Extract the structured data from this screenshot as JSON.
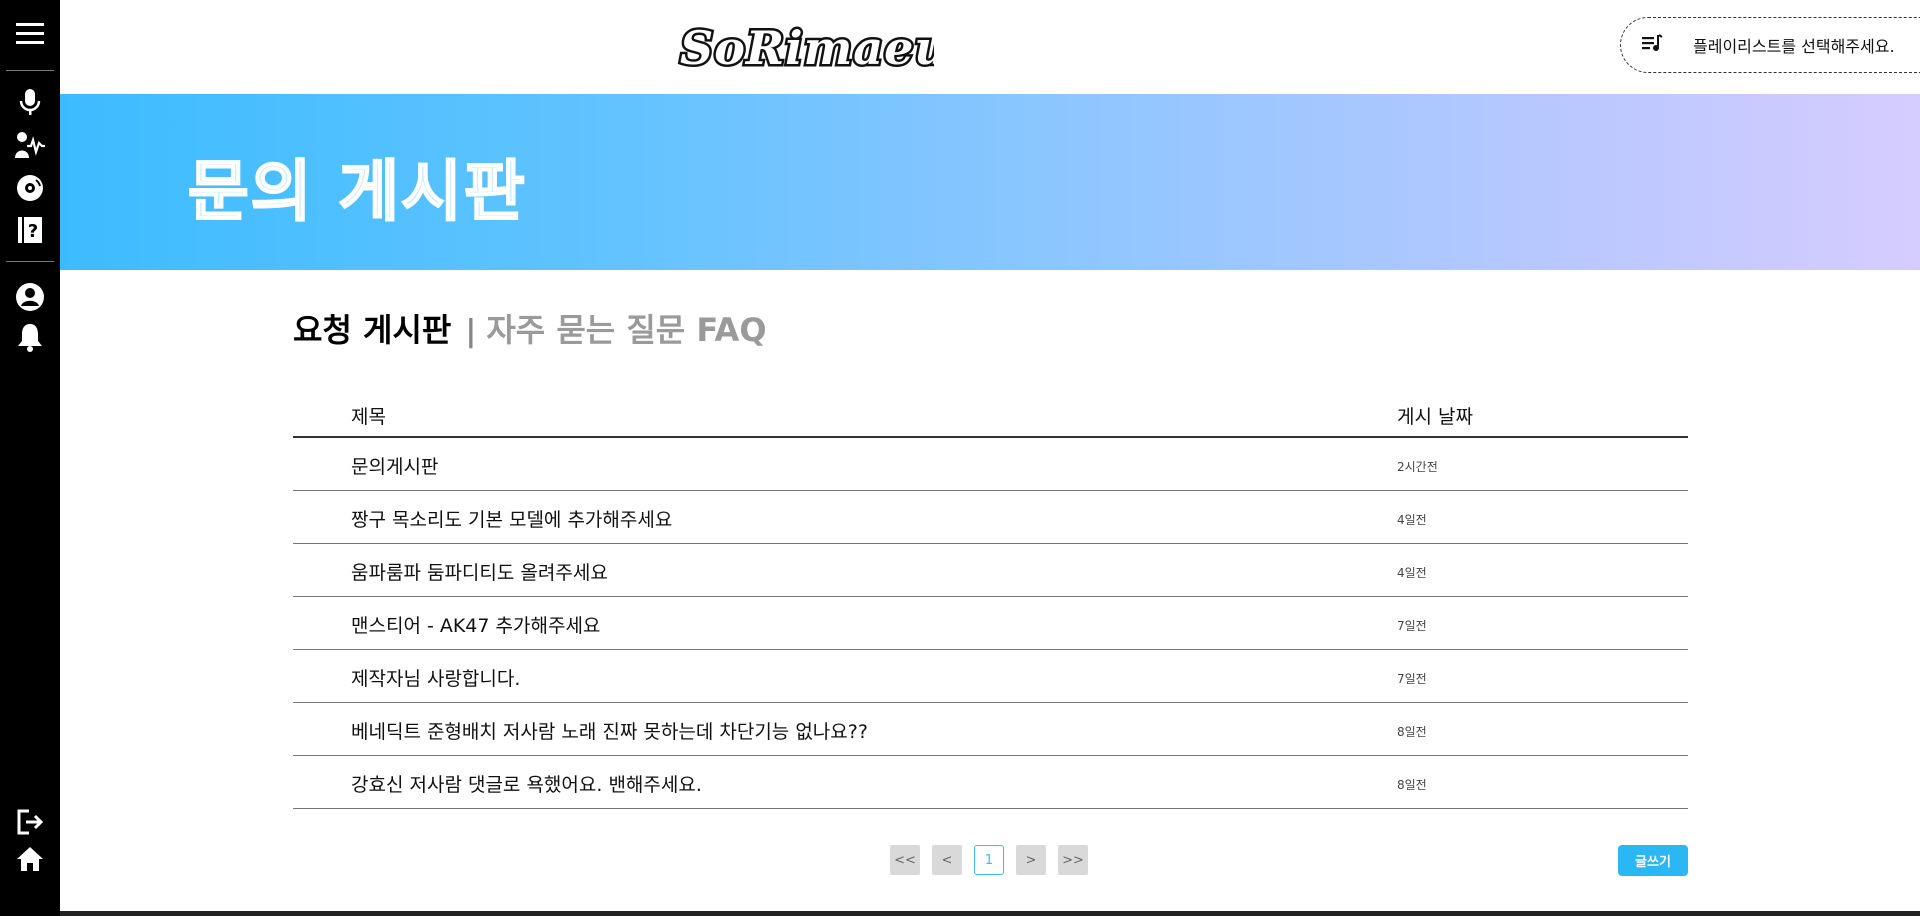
{
  "header": {
    "logo_text": "SoRimaeul",
    "playlist_placeholder": "플레이리스트를 선택해주세요."
  },
  "sidebar": {
    "icons": [
      "menu-icon",
      "microphone-icon",
      "voice-wave-icon",
      "disc-icon",
      "faq-book-icon",
      "user-icon",
      "bell-icon",
      "logout-icon",
      "home-icon"
    ]
  },
  "banner": {
    "title": "문의 게시판"
  },
  "board": {
    "tab_active": "요청 게시판",
    "tab_separator": "|",
    "tab_inactive": "자주 묻는 질문 FAQ",
    "columns": {
      "title": "제목",
      "date": "게시 날짜"
    },
    "rows": [
      {
        "title": "문의게시판",
        "date": "2시간전"
      },
      {
        "title": "짱구 목소리도 기본 모델에 추가해주세요",
        "date": "4일전"
      },
      {
        "title": "움파룸파 둠파디티도 올려주세요",
        "date": "4일전"
      },
      {
        "title": "맨스티어 - AK47 추가해주세요",
        "date": "7일전"
      },
      {
        "title": "제작자님 사랑합니다.",
        "date": "7일전"
      },
      {
        "title": "베네딕트 준형배치 저사람 노래 진짜 못하는데 차단기능 없나요??",
        "date": "8일전"
      },
      {
        "title": "강효신 저사람 댓글로 욕했어요. 밴해주세요.",
        "date": "8일전"
      }
    ]
  },
  "pagination": {
    "first": "<<",
    "prev": "<",
    "current": "1",
    "next": ">",
    "last": ">>"
  },
  "write_button": "글쓰기",
  "colors": {
    "accent": "#2bb6f4",
    "banner_start": "#3cbcff",
    "banner_end": "#d6ccff",
    "sidebar": "#000000"
  }
}
